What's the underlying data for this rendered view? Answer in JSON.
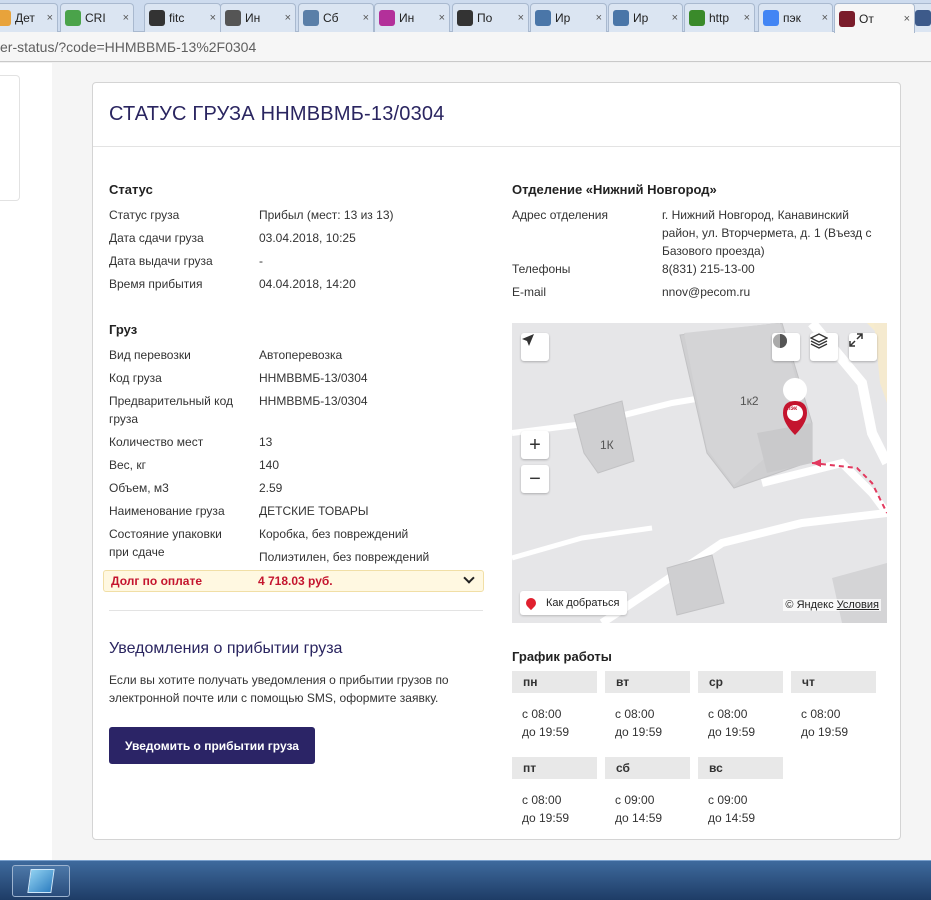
{
  "browser": {
    "tabs": [
      {
        "label": "Дет",
        "icon": "folder-icon",
        "color": "#e8a33b"
      },
      {
        "label": "CRI",
        "icon": "chrome-refresh-icon",
        "color": "#4aa34a"
      },
      {
        "label": "fitc",
        "icon": "bag-icon",
        "color": "#333333"
      },
      {
        "label": "Ин",
        "icon": "phone-icon",
        "color": "#555555"
      },
      {
        "label": "Сб",
        "icon": "nn-icon",
        "color": "#5a7fa8"
      },
      {
        "label": "Ин",
        "icon": "shopping-bag-icon",
        "color": "#b3309a"
      },
      {
        "label": "По",
        "icon": "bag-icon",
        "color": "#333333"
      },
      {
        "label": "Ир",
        "icon": "vk-icon",
        "color": "#4a76a8"
      },
      {
        "label": "Ир",
        "icon": "vk-icon",
        "color": "#4a76a8"
      },
      {
        "label": "http",
        "icon": "whatsapp-icon",
        "color": "#3a8a2a"
      },
      {
        "label": "пэк",
        "icon": "google-icon",
        "color": "#4285f4"
      },
      {
        "label": "От",
        "icon": "pek-icon",
        "color": "#7a1c2a"
      },
      {
        "label": "",
        "icon": "mail-icon",
        "color": "#3d5a8a"
      }
    ],
    "url": "er-status/?code=ННМВВМБ-13%2F0304"
  },
  "page": {
    "title": "СТАТУС ГРУЗА ННМВВМБ-13/0304",
    "status": {
      "heading": "Статус",
      "rows": [
        {
          "label": "Статус груза",
          "value": "Прибыл (мест: 13 из 13)"
        },
        {
          "label": "Дата сдачи груза",
          "value": "03.04.2018, 10:25"
        },
        {
          "label": "Дата выдачи груза",
          "value": "-"
        },
        {
          "label": "Время прибытия",
          "value": "04.04.2018, 14:20"
        }
      ]
    },
    "cargo": {
      "heading": "Груз",
      "rows": [
        {
          "label": "Вид перевозки",
          "value": "Автоперевозка"
        },
        {
          "label": "Код груза",
          "value": "ННМВВМБ-13/0304"
        },
        {
          "label": "Предварительный код груза",
          "value": "ННМВВМБ-13/0304"
        },
        {
          "label": "Количество мест",
          "value": "13"
        },
        {
          "label": "Вес, кг",
          "value": "140"
        },
        {
          "label": "Объем, м3",
          "value": "2.59"
        },
        {
          "label": "Наименование груза",
          "value": "ДЕТСКИЕ ТОВАРЫ"
        },
        {
          "label": "Состояние упаковки при сдаче",
          "value": "Коробка, без повреждений",
          "value2": "Полиэтилен, без повреждений"
        }
      ]
    },
    "debt": {
      "label": "Долг по оплате",
      "value": "4 718.03 руб."
    },
    "notify": {
      "heading": "Уведомления о прибытии груза",
      "text": "Если вы хотите получать уведомления о прибытии грузов по электронной почте или с помощью SMS, оформите заявку.",
      "button": "Уведомить о прибытии груза"
    },
    "office": {
      "heading": "Отделение «Нижний Новгород»",
      "address_label": "Адрес отделения",
      "address": "г. Нижний Новгород, Канавинский район, ул. Вторчермета, д. 1 (Въезд с Базового проезда)",
      "phone_label": "Телефоны",
      "phone": "8(831) 215-13-00",
      "email_label": "E-mail",
      "email": "nnov@pecom.ru"
    },
    "map": {
      "building1": "1к2",
      "building2": "1К",
      "route": "Как добраться",
      "copyright": "© Яндекс",
      "terms": "Условия",
      "pin_label": "пэк"
    },
    "schedule": {
      "heading": "График работы",
      "days": [
        {
          "day": "пн",
          "from": "с 08:00",
          "to": "до 19:59"
        },
        {
          "day": "вт",
          "from": "с 08:00",
          "to": "до 19:59"
        },
        {
          "day": "ср",
          "from": "с 08:00",
          "to": "до 19:59"
        },
        {
          "day": "чт",
          "from": "с 08:00",
          "to": "до 19:59"
        },
        {
          "day": "пт",
          "from": "с 08:00",
          "to": "до 19:59"
        },
        {
          "day": "сб",
          "from": "с 09:00",
          "to": "до 14:59"
        },
        {
          "day": "вс",
          "from": "с 09:00",
          "to": "до 14:59"
        }
      ]
    }
  },
  "colors": {
    "brand": "#2b2466",
    "debt": "#c4142e",
    "pin": "#c4142e"
  }
}
